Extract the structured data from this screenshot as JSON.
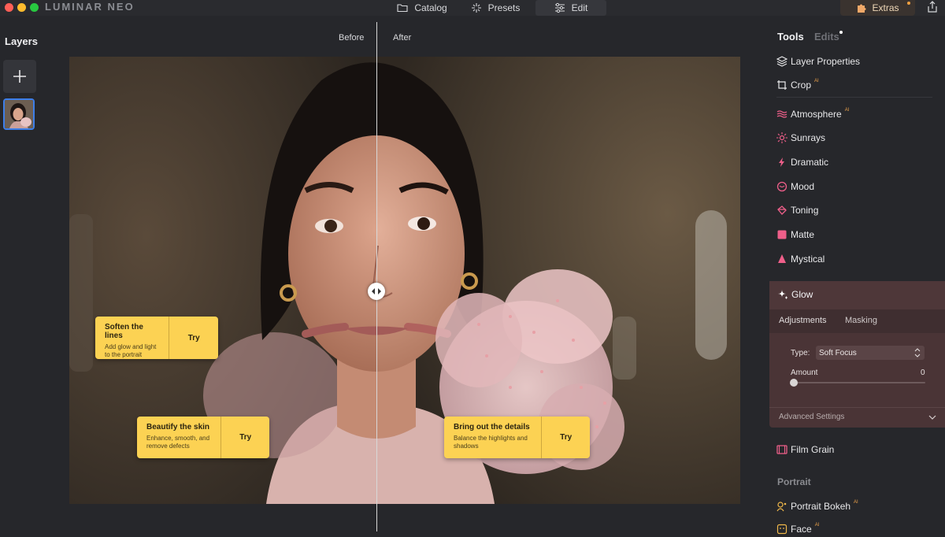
{
  "app": {
    "brand": "LUMINAR NEO"
  },
  "topnav": {
    "catalog": "Catalog",
    "presets": "Presets",
    "edit": "Edit",
    "extras": "Extras"
  },
  "layers": {
    "title": "Layers"
  },
  "compare": {
    "before": "Before",
    "after": "After"
  },
  "tips": [
    {
      "title": "Soften the lines",
      "desc": "Add glow and light to the portrait",
      "action": "Try"
    },
    {
      "title": "Beautify the skin",
      "desc": "Enhance, smooth, and remove defects",
      "action": "Try"
    },
    {
      "title": "Bring out the details",
      "desc": "Balance the highlights and shadows",
      "action": "Try"
    }
  ],
  "panel": {
    "tabs": {
      "tools": "Tools",
      "edits": "Edits"
    },
    "tools": [
      {
        "label": "Layer Properties",
        "ai": ""
      },
      {
        "label": "Crop",
        "ai": "AI"
      },
      {
        "label": "Atmosphere",
        "ai": "AI"
      },
      {
        "label": "Sunrays",
        "ai": ""
      },
      {
        "label": "Dramatic",
        "ai": ""
      },
      {
        "label": "Mood",
        "ai": ""
      },
      {
        "label": "Toning",
        "ai": ""
      },
      {
        "label": "Matte",
        "ai": ""
      },
      {
        "label": "Mystical",
        "ai": ""
      }
    ],
    "glow": {
      "title": "Glow",
      "tab_adjustments": "Adjustments",
      "tab_masking": "Masking",
      "type_label": "Type:",
      "type_value": "Soft Focus",
      "amount_label": "Amount",
      "amount_value": "0",
      "advanced": "Advanced Settings"
    },
    "film_grain": "Film Grain",
    "portrait_section": "Portrait",
    "portrait_tools": [
      {
        "label": "Portrait Bokeh",
        "ai": "AI"
      },
      {
        "label": "Face",
        "ai": "AI"
      }
    ]
  },
  "colors": {
    "accent_tip": "#fcd253",
    "ai_badge": "#e9a04a",
    "glow_panel": "#4a3436",
    "selection": "#3d7ee8"
  },
  "icons": {
    "catalog": "folder-icon",
    "presets": "sparkle-icon",
    "edit": "sliders-icon",
    "extras": "puzzle-icon",
    "share": "share-icon",
    "add_layer": "plus-icon",
    "split": "split-arrows-icon"
  }
}
